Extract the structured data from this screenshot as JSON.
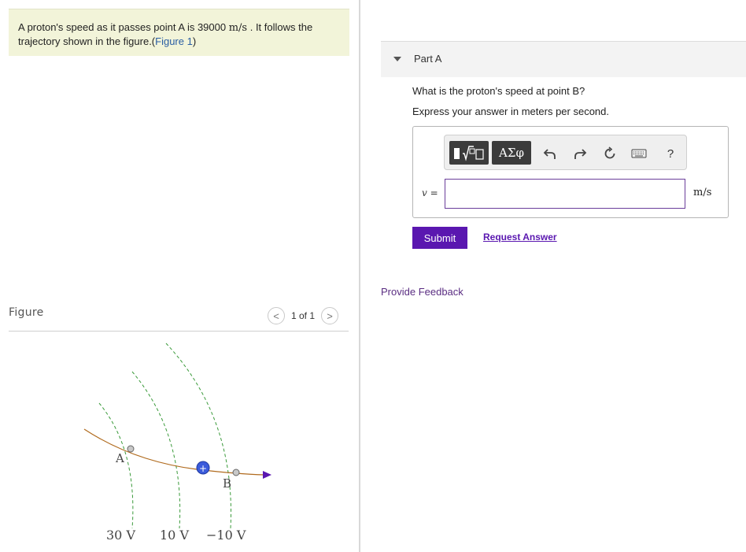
{
  "problem": {
    "text_before": "A proton's speed as it passes point A is 39000 ",
    "unit": "m/s",
    "text_after": " . It follows the trajectory shown in the figure.(",
    "figure_link": "Figure 1",
    "text_close": ")"
  },
  "figure": {
    "label": "Figure",
    "pager_text": "1 of 1",
    "prev_symbol": "<",
    "next_symbol": ">",
    "point_a": "A",
    "point_b": "B",
    "proton_symbol": "+",
    "voltages": [
      "30 V",
      "10 V",
      "−10 V"
    ]
  },
  "part": {
    "title": "Part A",
    "question": "What is the proton's speed at point B?",
    "instruction": "Express your answer in meters per second.",
    "variable_label": "v =",
    "answer_value": "",
    "unit": "m/s",
    "greek_button": "ΑΣφ",
    "help_symbol": "?",
    "submit_label": "Submit",
    "request_label": "Request Answer"
  },
  "feedback_label": "Provide Feedback",
  "colors": {
    "accent": "#5a17b0",
    "problem_bg": "#f2f4d9",
    "trajectory": "#b06a1d",
    "equipotential": "#3a9a3a",
    "proton": "#3b5bdb"
  }
}
